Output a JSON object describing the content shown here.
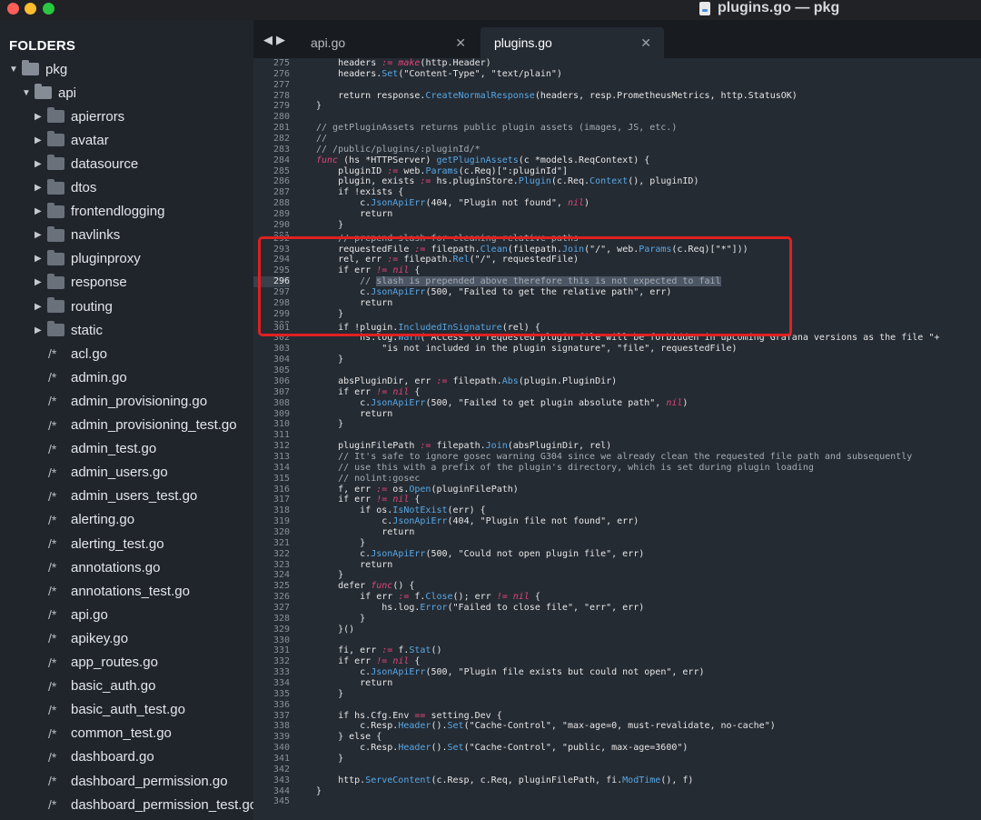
{
  "window": {
    "title": "plugins.go — pkg"
  },
  "sidebar": {
    "title": "FOLDERS",
    "tree": [
      {
        "label": "pkg",
        "type": "folder",
        "open": true,
        "depth": 0
      },
      {
        "label": "api",
        "type": "folder",
        "open": true,
        "depth": 1
      },
      {
        "label": "apierrors",
        "type": "folder",
        "open": false,
        "depth": 2
      },
      {
        "label": "avatar",
        "type": "folder",
        "open": false,
        "depth": 2
      },
      {
        "label": "datasource",
        "type": "folder",
        "open": false,
        "depth": 2
      },
      {
        "label": "dtos",
        "type": "folder",
        "open": false,
        "depth": 2
      },
      {
        "label": "frontendlogging",
        "type": "folder",
        "open": false,
        "depth": 2
      },
      {
        "label": "navlinks",
        "type": "folder",
        "open": false,
        "depth": 2
      },
      {
        "label": "pluginproxy",
        "type": "folder",
        "open": false,
        "depth": 2
      },
      {
        "label": "response",
        "type": "folder",
        "open": false,
        "depth": 2
      },
      {
        "label": "routing",
        "type": "folder",
        "open": false,
        "depth": 2
      },
      {
        "label": "static",
        "type": "folder",
        "open": false,
        "depth": 2
      },
      {
        "label": "acl.go",
        "type": "file",
        "depth": 2
      },
      {
        "label": "admin.go",
        "type": "file",
        "depth": 2
      },
      {
        "label": "admin_provisioning.go",
        "type": "file",
        "depth": 2
      },
      {
        "label": "admin_provisioning_test.go",
        "type": "file",
        "depth": 2
      },
      {
        "label": "admin_test.go",
        "type": "file",
        "depth": 2
      },
      {
        "label": "admin_users.go",
        "type": "file",
        "depth": 2
      },
      {
        "label": "admin_users_test.go",
        "type": "file",
        "depth": 2
      },
      {
        "label": "alerting.go",
        "type": "file",
        "depth": 2
      },
      {
        "label": "alerting_test.go",
        "type": "file",
        "depth": 2
      },
      {
        "label": "annotations.go",
        "type": "file",
        "depth": 2
      },
      {
        "label": "annotations_test.go",
        "type": "file",
        "depth": 2
      },
      {
        "label": "api.go",
        "type": "file",
        "depth": 2
      },
      {
        "label": "apikey.go",
        "type": "file",
        "depth": 2
      },
      {
        "label": "app_routes.go",
        "type": "file",
        "depth": 2
      },
      {
        "label": "basic_auth.go",
        "type": "file",
        "depth": 2
      },
      {
        "label": "basic_auth_test.go",
        "type": "file",
        "depth": 2
      },
      {
        "label": "common_test.go",
        "type": "file",
        "depth": 2
      },
      {
        "label": "dashboard.go",
        "type": "file",
        "depth": 2
      },
      {
        "label": "dashboard_permission.go",
        "type": "file",
        "depth": 2
      },
      {
        "label": "dashboard_permission_test.go",
        "type": "file",
        "depth": 2
      }
    ],
    "file_glyph": "/*"
  },
  "tabs": [
    {
      "label": "api.go",
      "active": false,
      "close": "✕"
    },
    {
      "label": "plugins.go",
      "active": true,
      "close": "✕"
    }
  ],
  "editor": {
    "current_line": 296,
    "lines": [
      {
        "n": "275",
        "t": "    headers := make(http.Header)"
      },
      {
        "n": "276",
        "t": "    headers.Set(\"Content-Type\", \"text/plain\")"
      },
      {
        "n": "277",
        "t": ""
      },
      {
        "n": "278",
        "t": "    return response.CreateNormalResponse(headers, resp.PrometheusMetrics, http.StatusOK)"
      },
      {
        "n": "279",
        "t": "}"
      },
      {
        "n": "280",
        "t": ""
      },
      {
        "n": "281",
        "t": "// getPluginAssets returns public plugin assets (images, JS, etc.)"
      },
      {
        "n": "282",
        "t": "//"
      },
      {
        "n": "283",
        "t": "// /public/plugins/:pluginId/*"
      },
      {
        "n": "284",
        "t": "func (hs *HTTPServer) getPluginAssets(c *models.ReqContext) {"
      },
      {
        "n": "285",
        "t": "    pluginID := web.Params(c.Req)[\":pluginId\"]"
      },
      {
        "n": "286",
        "t": "    plugin, exists := hs.pluginStore.Plugin(c.Req.Context(), pluginID)"
      },
      {
        "n": "287",
        "t": "    if !exists {"
      },
      {
        "n": "288",
        "t": "        c.JsonApiErr(404, \"Plugin not found\", nil)"
      },
      {
        "n": "289",
        "t": "        return"
      },
      {
        "n": "290",
        "t": "    }"
      },
      {
        "n": "291",
        "t": "",
        "tiny": true
      },
      {
        "n": "292",
        "t": "    // prepend slash for cleaning relative paths"
      },
      {
        "n": "293",
        "t": "    requestedFile := filepath.Clean(filepath.Join(\"/\", web.Params(c.Req)[\"*\"]))"
      },
      {
        "n": "294",
        "t": "    rel, err := filepath.Rel(\"/\", requestedFile)"
      },
      {
        "n": "295",
        "t": "    if err != nil {"
      },
      {
        "n": "296",
        "t": "        // slash is prepended above therefore this is not expected to fail"
      },
      {
        "n": "297",
        "t": "        c.JsonApiErr(500, \"Failed to get the relative path\", err)"
      },
      {
        "n": "298",
        "t": "        return"
      },
      {
        "n": "299",
        "t": "    }"
      },
      {
        "n": "300",
        "t": "",
        "tiny": true
      },
      {
        "n": "301",
        "t": "    if !plugin.IncludedInSignature(rel) {"
      },
      {
        "n": "302",
        "t": "        hs.log.Warn(\"Access to requested plugin file will be forbidden in upcoming Grafana versions as the file \"+"
      },
      {
        "n": "303",
        "t": "            \"is not included in the plugin signature\", \"file\", requestedFile)"
      },
      {
        "n": "304",
        "t": "    }"
      },
      {
        "n": "305",
        "t": ""
      },
      {
        "n": "306",
        "t": "    absPluginDir, err := filepath.Abs(plugin.PluginDir)"
      },
      {
        "n": "307",
        "t": "    if err != nil {"
      },
      {
        "n": "308",
        "t": "        c.JsonApiErr(500, \"Failed to get plugin absolute path\", nil)"
      },
      {
        "n": "309",
        "t": "        return"
      },
      {
        "n": "310",
        "t": "    }"
      },
      {
        "n": "311",
        "t": ""
      },
      {
        "n": "312",
        "t": "    pluginFilePath := filepath.Join(absPluginDir, rel)"
      },
      {
        "n": "313",
        "t": "    // It's safe to ignore gosec warning G304 since we already clean the requested file path and subsequently"
      },
      {
        "n": "314",
        "t": "    // use this with a prefix of the plugin's directory, which is set during plugin loading"
      },
      {
        "n": "315",
        "t": "    // nolint:gosec"
      },
      {
        "n": "316",
        "t": "    f, err := os.Open(pluginFilePath)"
      },
      {
        "n": "317",
        "t": "    if err != nil {"
      },
      {
        "n": "318",
        "t": "        if os.IsNotExist(err) {"
      },
      {
        "n": "319",
        "t": "            c.JsonApiErr(404, \"Plugin file not found\", err)"
      },
      {
        "n": "320",
        "t": "            return"
      },
      {
        "n": "321",
        "t": "        }"
      },
      {
        "n": "322",
        "t": "        c.JsonApiErr(500, \"Could not open plugin file\", err)"
      },
      {
        "n": "323",
        "t": "        return"
      },
      {
        "n": "324",
        "t": "    }"
      },
      {
        "n": "325",
        "t": "    defer func() {"
      },
      {
        "n": "326",
        "t": "        if err := f.Close(); err != nil {"
      },
      {
        "n": "327",
        "t": "            hs.log.Error(\"Failed to close file\", \"err\", err)"
      },
      {
        "n": "328",
        "t": "        }"
      },
      {
        "n": "329",
        "t": "    }()"
      },
      {
        "n": "330",
        "t": ""
      },
      {
        "n": "331",
        "t": "    fi, err := f.Stat()"
      },
      {
        "n": "332",
        "t": "    if err != nil {"
      },
      {
        "n": "333",
        "t": "        c.JsonApiErr(500, \"Plugin file exists but could not open\", err)"
      },
      {
        "n": "334",
        "t": "        return"
      },
      {
        "n": "335",
        "t": "    }"
      },
      {
        "n": "336",
        "t": ""
      },
      {
        "n": "337",
        "t": "    if hs.Cfg.Env == setting.Dev {"
      },
      {
        "n": "338",
        "t": "        c.Resp.Header().Set(\"Cache-Control\", \"max-age=0, must-revalidate, no-cache\")"
      },
      {
        "n": "339",
        "t": "    } else {"
      },
      {
        "n": "340",
        "t": "        c.Resp.Header().Set(\"Cache-Control\", \"public, max-age=3600\")"
      },
      {
        "n": "341",
        "t": "    }"
      },
      {
        "n": "342",
        "t": ""
      },
      {
        "n": "343",
        "t": "    http.ServeContent(c.Resp, c.Req, pluginFilePath, fi.ModTime(), f)"
      },
      {
        "n": "344",
        "t": "}"
      },
      {
        "n": "345",
        "t": ""
      }
    ]
  },
  "colors": {
    "highlight_box": "#e02020",
    "keyword": "#e0457a",
    "function": "#57a8e6",
    "comment": "#a6acb3"
  }
}
